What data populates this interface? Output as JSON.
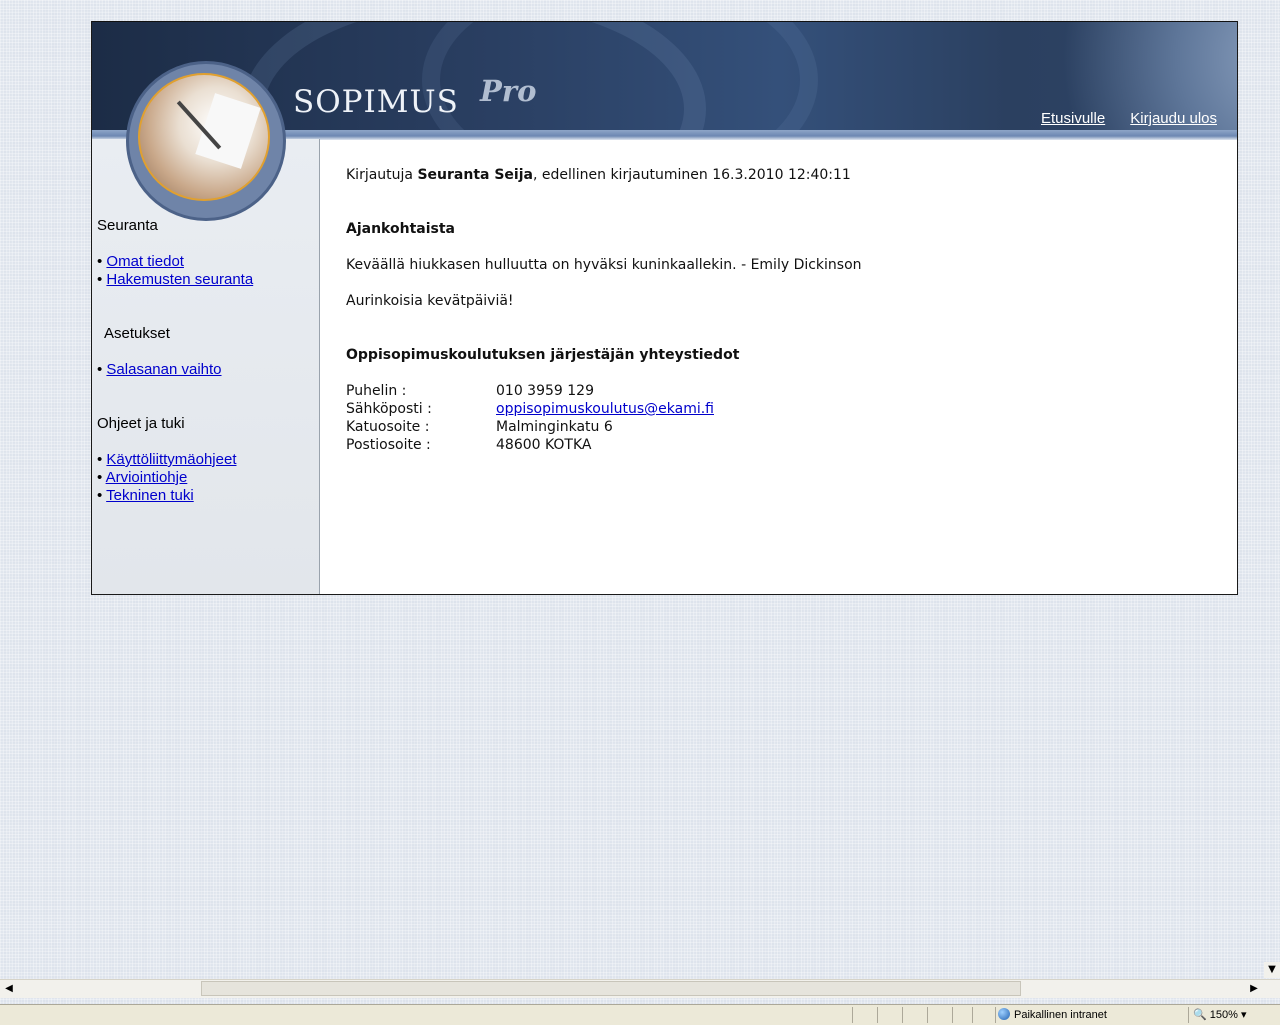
{
  "header": {
    "logo": "SOPIMUS",
    "logo_suffix": "Pro",
    "links": {
      "home": "Etusivulle",
      "logout": "Kirjaudu ulos"
    }
  },
  "sidebar": {
    "sections": [
      {
        "title": "Seuranta",
        "items": [
          "Omat tiedot",
          "Hakemusten seuranta"
        ]
      },
      {
        "title": "Asetukset",
        "items": [
          "Salasanan vaihto"
        ]
      },
      {
        "title": "Ohjeet ja tuki",
        "items": [
          "Käyttöliittymäohjeet",
          "Arviointiohje",
          "Tekninen tuki"
        ]
      }
    ]
  },
  "main": {
    "login_prefix": "Kirjautuja",
    "login_user": "Seuranta Seija",
    "login_suffix": ", edellinen kirjautuminen 16.3.2010 12:40:11",
    "news_heading": "Ajankohtaista",
    "news_quote": "Keväällä hiukkasen hulluutta on hyväksi kuninkaallekin. - Emily Dickinson",
    "news_greeting": "Aurinkoisia kevätpäiviä!",
    "contact_heading": "Oppisopimuskoulutuksen järjestäjän yhteystiedot",
    "contact": {
      "phone_label": "Puhelin :",
      "phone": "010 3959 129",
      "email_label": "Sähköposti :",
      "email": "oppisopimuskoulutus@ekami.fi",
      "street_label": "Katuosoite :",
      "street": "Malminginkatu 6",
      "postal_label": "Postiosoite :",
      "postal": "48600 KOTKA"
    }
  },
  "statusbar": {
    "zone": "Paikallinen intranet",
    "zoom": "150%"
  }
}
